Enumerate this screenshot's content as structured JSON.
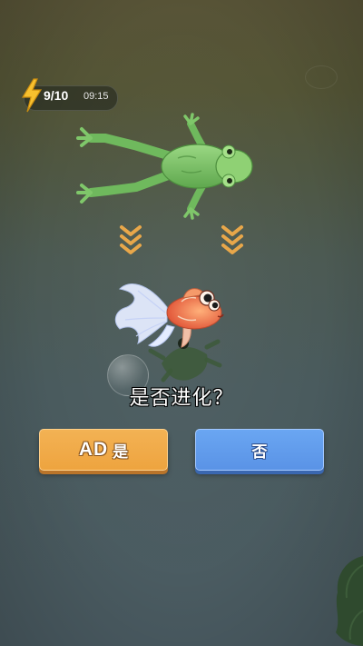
{
  "hud": {
    "energy_icon": "lightning-bolt-icon",
    "energy_count": "9/10",
    "energy_timer": "09:15"
  },
  "creatures": {
    "current": "frog",
    "evolved": "goldfish"
  },
  "indicators": {
    "arrow_icon": "chevron-down-icon"
  },
  "dialog": {
    "question": "是否进化？",
    "yes_ad_tag": "AD",
    "yes_label": "是",
    "no_label": "否"
  },
  "colors": {
    "yes_button": "#eea43f",
    "no_button": "#5a93e6",
    "water_top": "#585437",
    "water_bottom": "#4b5c63",
    "frog_green": "#7fc76a"
  }
}
